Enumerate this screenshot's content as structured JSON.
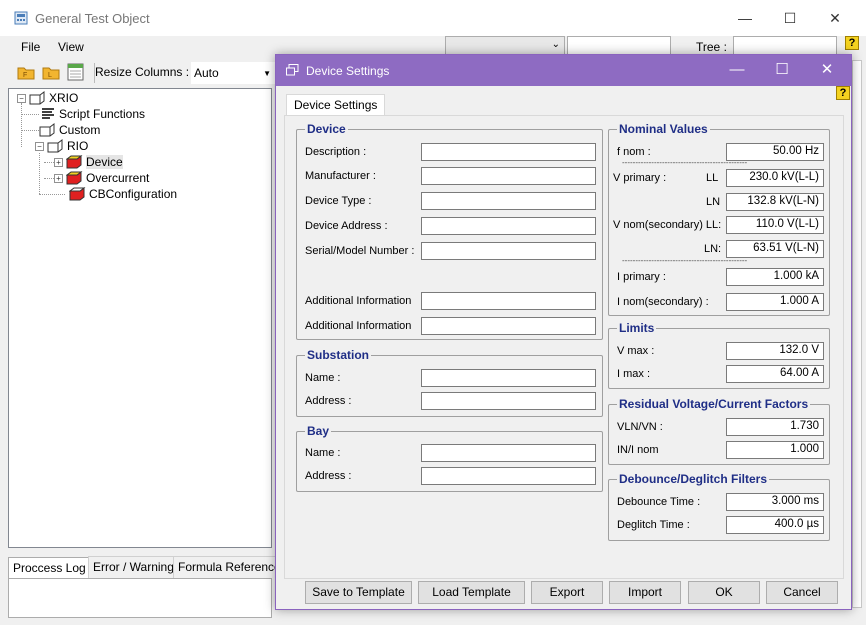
{
  "main_window": {
    "title": "General Test Object",
    "menu": {
      "file": "File",
      "view": "View"
    },
    "toolbar": {
      "resize_label": "Resize Columns :",
      "resize_value": "Auto"
    },
    "tree_label": "Tree :",
    "tree": {
      "xrio": "XRIO",
      "script_functions": "Script Functions",
      "custom": "Custom",
      "rio": "RIO",
      "device": "Device",
      "overcurrent": "Overcurrent",
      "cb_configuration": "CBConfiguration"
    },
    "bottom_tabs": [
      "Proccess Log",
      "Error / Warning",
      "Formula References"
    ]
  },
  "dialog": {
    "title": "Device Settings",
    "tab": "Device Settings",
    "device": {
      "legend": "Device",
      "description": "Description :",
      "manufacturer": "Manufacturer :",
      "device_type": "Device Type :",
      "device_address": "Device Address :",
      "serial_model": "Serial/Model Number :",
      "additional_info_1": "Additional Information",
      "additional_info_2": "Additional Information"
    },
    "substation": {
      "legend": "Substation",
      "name": "Name :",
      "address": "Address :"
    },
    "bay": {
      "legend": "Bay",
      "name": "Name :",
      "address": "Address :"
    },
    "nominal": {
      "legend": "Nominal Values",
      "f_nom_label": "f nom :",
      "f_nom_value": "50.00 Hz",
      "v_primary_label": "V primary :",
      "ll_label": "LL",
      "v_primary_ll": "230.0 kV(L-L)",
      "ln_label": "LN",
      "v_primary_ln": "132.8 kV(L-N)",
      "v_nom_sec_label": "V nom(secondary) LL:",
      "v_nom_sec_ll": "110.0 V(L-L)",
      "ln2_label": "LN:",
      "v_nom_sec_ln": "63.51 V(L-N)",
      "i_primary_label": "I primary :",
      "i_primary_value": "1.000 kA",
      "i_nom_sec_label": "I nom(secondary) :",
      "i_nom_sec_value": "1.000 A"
    },
    "limits": {
      "legend": "Limits",
      "v_max_label": "V max :",
      "v_max_value": "132.0 V",
      "i_max_label": "I max :",
      "i_max_value": "64.00 A"
    },
    "residual": {
      "legend": "Residual Voltage/Current Factors",
      "vln_vn_label": "VLN/VN :",
      "vln_vn_value": "1.730",
      "in_inom_label": "IN/I nom",
      "in_inom_value": "1.000"
    },
    "debounce": {
      "legend": "Debounce/Deglitch Filters",
      "debounce_label": "Debounce Time :",
      "debounce_value": "3.000 ms",
      "deglitch_label": "Deglitch Time :",
      "deglitch_value": "400.0 µs"
    },
    "buttons": {
      "save_template": "Save to Template",
      "load_template": "Load Template",
      "export": "Export",
      "import": "Import",
      "ok": "OK",
      "cancel": "Cancel"
    }
  },
  "icons": {
    "app": "app-icon",
    "open_folder": "open-folder-icon",
    "load_folder": "load-folder-icon",
    "calendar": "calendar-icon",
    "help": "help-icon",
    "dialog": "dialog-window-icon"
  },
  "colors": {
    "dialog_title": "#8e6bc2",
    "group_legend": "#1f2e86",
    "help_badge": "#f4d21f"
  }
}
